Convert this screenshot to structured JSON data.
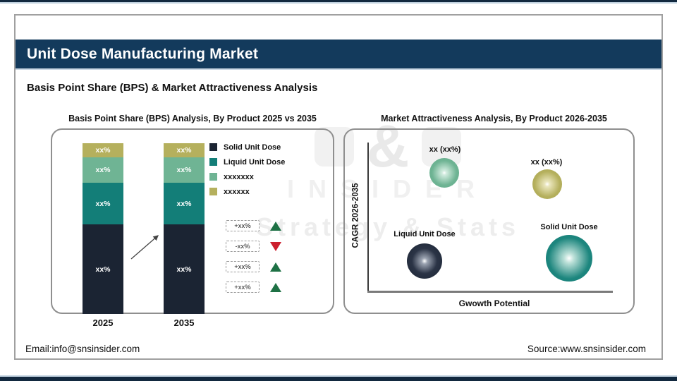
{
  "header": {
    "title": "Unit Dose Manufacturing Market",
    "subtitle": "Basis Point Share (BPS) & Market Attractiveness Analysis"
  },
  "footer": {
    "email": "Email:info@snsinsider.com",
    "source": "Source:www.snsinsider.com"
  },
  "watermark": {
    "amp": "&",
    "insider": "INSIDER",
    "strategy": "Strategy & Stats"
  },
  "colors": {
    "band_navy": "#133a5c",
    "strip_navy": "#12293f",
    "up_green": "#1e7145",
    "down_red": "#cc1f2e"
  },
  "chart_data": [
    {
      "type": "bar",
      "subtype": "stacked-column",
      "title": "Basis Point Share (BPS) Analysis, By Product 2025 vs 2035",
      "categories": [
        "2025",
        "2035"
      ],
      "legend_position": "right",
      "series": [
        {
          "name": "Solid Unit Dose",
          "color": "#1b2433",
          "values": [
            "xx%",
            "xx%"
          ],
          "approx_share_pct": [
            52,
            52
          ]
        },
        {
          "name": "Liquid Unit Dose",
          "color": "#137e78",
          "values": [
            "xx%",
            "xx%"
          ],
          "approx_share_pct": [
            24,
            24
          ]
        },
        {
          "name": "xxxxxxx",
          "color": "#6fb494",
          "values": [
            "xx%",
            "xx%"
          ],
          "approx_share_pct": [
            15,
            15
          ]
        },
        {
          "name": "xxxxxx",
          "color": "#b5b05d",
          "values": [
            "xx%",
            "xx%"
          ],
          "approx_share_pct": [
            9,
            9
          ]
        }
      ],
      "annotations": [
        {
          "text": "+xx%",
          "arrow": "up",
          "color": "#1e7145"
        },
        {
          "text": "-xx%",
          "arrow": "down",
          "color": "#cc1f2e"
        },
        {
          "text": "+xx%",
          "arrow": "up",
          "color": "#1e7145"
        },
        {
          "text": "+xx%",
          "arrow": "up",
          "color": "#1e7145"
        }
      ]
    },
    {
      "type": "scatter",
      "subtype": "bubble",
      "title": "Market Attractiveness Analysis, By Product 2026-2035",
      "xlabel": "Gwowth Potential",
      "ylabel": "CAGR 2026-2035",
      "grid": false,
      "points": [
        {
          "label": "xx (xx%)",
          "color": "#6fb494",
          "x_rel": 0.31,
          "y_rel": 0.8,
          "radius_px": 21
        },
        {
          "label": "xx (xx%)",
          "color": "#b5b05d",
          "x_rel": 0.73,
          "y_rel": 0.72,
          "radius_px": 21
        },
        {
          "label": "Liquid Unit Dose",
          "color": "#1b2433",
          "x_rel": 0.23,
          "y_rel": 0.21,
          "radius_px": 25
        },
        {
          "label": "Solid Unit Dose",
          "color": "#137e78",
          "x_rel": 0.82,
          "y_rel": 0.22,
          "radius_px": 33
        }
      ]
    }
  ]
}
